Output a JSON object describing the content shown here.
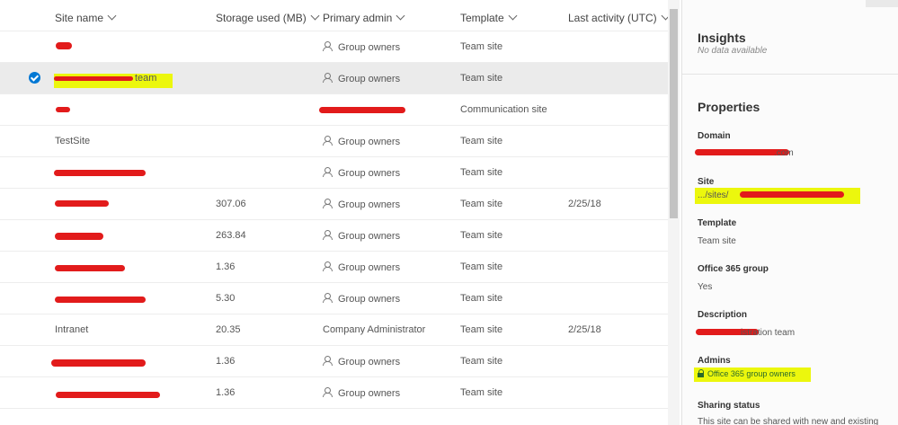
{
  "columns": {
    "site_name": "Site name",
    "storage": "Storage used (MB)",
    "primary_admin": "Primary admin",
    "template": "Template",
    "last_activity": "Last activity (UTC)"
  },
  "rows": [
    {
      "name": "",
      "storage": "",
      "admin": "Group owners",
      "template": "Team site",
      "activity": ""
    },
    {
      "name": "team",
      "storage": "",
      "admin": "Group owners",
      "template": "Team site",
      "activity": "",
      "selected": true
    },
    {
      "name": "",
      "storage": "",
      "admin": "",
      "template": "Communication site",
      "activity": ""
    },
    {
      "name": "TestSite",
      "storage": "",
      "admin": "Group owners",
      "template": "Team site",
      "activity": ""
    },
    {
      "name": "",
      "storage": "",
      "admin": "Group owners",
      "template": "Team site",
      "activity": ""
    },
    {
      "name": "",
      "storage": "307.06",
      "admin": "Group owners",
      "template": "Team site",
      "activity": "2/25/18"
    },
    {
      "name": "",
      "storage": "263.84",
      "admin": "Group owners",
      "template": "Team site",
      "activity": ""
    },
    {
      "name": "",
      "storage": "1.36",
      "admin": "Group owners",
      "template": "Team site",
      "activity": ""
    },
    {
      "name": "",
      "storage": "5.30",
      "admin": "Group owners",
      "template": "Team site",
      "activity": ""
    },
    {
      "name": "Intranet",
      "storage": "20.35",
      "admin": "Company Administrator",
      "template": "Team site",
      "activity": "2/25/18"
    },
    {
      "name": "",
      "storage": "1.36",
      "admin": "Group owners",
      "template": "Team site",
      "activity": ""
    },
    {
      "name": "",
      "storage": "1.36",
      "admin": "Group owners",
      "template": "Team site",
      "activity": ""
    }
  ],
  "panel": {
    "insights_title": "Insights",
    "insights_empty": "No data available",
    "properties_title": "Properties",
    "domain_label": "Domain",
    "domain_value": ".com",
    "site_label": "Site",
    "site_value": ".../sites/",
    "template_label": "Template",
    "template_value": "Team site",
    "o365_label": "Office 365 group",
    "o365_value": "Yes",
    "description_label": "Description",
    "description_value": "istration team",
    "admins_label": "Admins",
    "admins_value": "Office 365 group owners",
    "sharing_label": "Sharing status",
    "sharing_value": "This site can be shared with new and existing"
  },
  "colors": {
    "accent": "#0078d4",
    "selected_row": "#ebebeb",
    "redaction": "#e21b1b",
    "highlight": "#ecf70d",
    "admin_link": "#2a6a2a"
  },
  "icons": {
    "column_sort": "chevron-down-icon",
    "admin": "person-icon",
    "selection": "checkmark-circle-icon",
    "group": "lock-icon"
  }
}
